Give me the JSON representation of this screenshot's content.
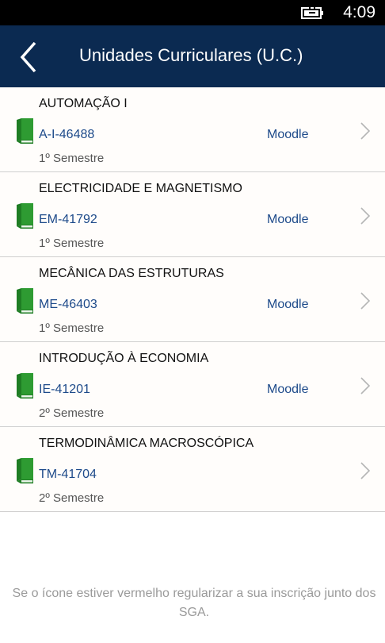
{
  "status_bar": {
    "time": "4:09",
    "battery_icon": "battery-charging-icon"
  },
  "header": {
    "back_icon": "chevron-left-icon",
    "title": "Unidades Curriculares (U.C.)",
    "background_color": "#0b2a51"
  },
  "items": [
    {
      "name": "AUTOMAÇÃO I",
      "code": "A-I-46488",
      "link": "Moodle",
      "semester": "1º Semestre",
      "icon": "book-icon",
      "icon_color": "#2e9b32"
    },
    {
      "name": "ELECTRICIDADE E MAGNETISMO",
      "code": "EM-41792",
      "link": "Moodle",
      "semester": "1º Semestre",
      "icon": "book-icon",
      "icon_color": "#2e9b32"
    },
    {
      "name": "MECÂNICA DAS ESTRUTURAS",
      "code": "ME-46403",
      "link": "Moodle",
      "semester": "1º Semestre",
      "icon": "book-icon",
      "icon_color": "#2e9b32"
    },
    {
      "name": "INTRODUÇÃO À ECONOMIA",
      "code": "IE-41201",
      "link": "Moodle",
      "semester": "2º Semestre",
      "icon": "book-icon",
      "icon_color": "#2e9b32"
    },
    {
      "name": "TERMODINÂMICA MACROSCÓPICA",
      "code": "TM-41704",
      "link": "",
      "semester": "2º Semestre",
      "icon": "book-icon",
      "icon_color": "#2e9b32"
    }
  ],
  "footer": {
    "note": "Se o ícone estiver vermelho regularizar a sua inscrição junto dos SGA."
  },
  "colors": {
    "link": "#1d4a8a",
    "divider": "#cfcfcf"
  }
}
